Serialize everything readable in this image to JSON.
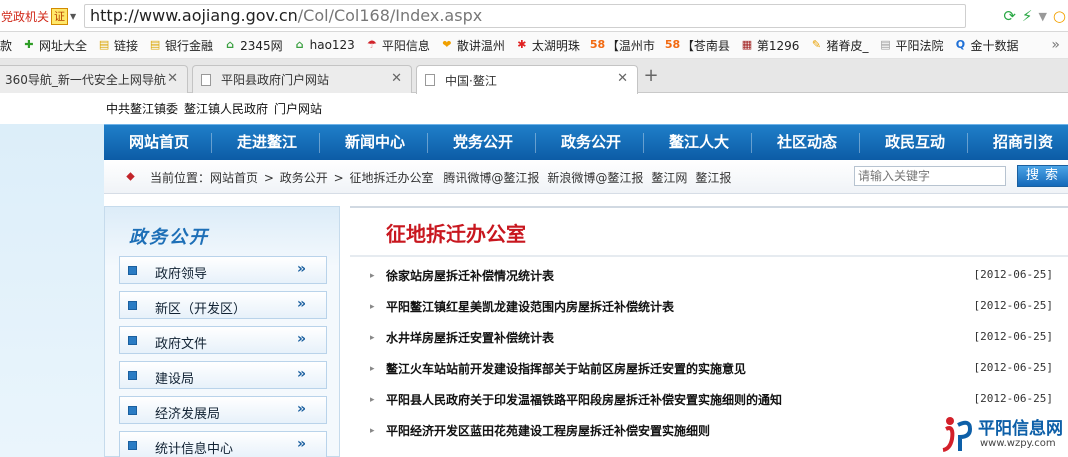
{
  "browser": {
    "org_tag": "党政机关",
    "cert_badge": "证",
    "url_host": "http://www.aojiang.gov.cn",
    "url_path": "/Col/Col168/Index.aspx",
    "bookmarks": [
      {
        "label": "款",
        "icon": "",
        "color": "#333"
      },
      {
        "label": "网址大全",
        "icon": "✚",
        "color": "#2f9d27"
      },
      {
        "label": "链接",
        "icon": "▤",
        "color": "#d9a400"
      },
      {
        "label": "银行金融",
        "icon": "▤",
        "color": "#d9a400"
      },
      {
        "label": "2345网",
        "icon": "⌂",
        "color": "#3aa040"
      },
      {
        "label": "hao123",
        "icon": "⌂",
        "color": "#3aa040"
      },
      {
        "label": "平阳信息",
        "icon": "☂",
        "color": "#d1232a"
      },
      {
        "label": "散讲温州",
        "icon": "❤",
        "color": "#f0a000"
      },
      {
        "label": "太湖明珠",
        "icon": "✱",
        "color": "#e02020"
      },
      {
        "label": "【温州市",
        "icon": "58",
        "color": "#f26a11"
      },
      {
        "label": "【苍南县",
        "icon": "58",
        "color": "#f26a11"
      },
      {
        "label": "第1296",
        "icon": "▦",
        "color": "#a02020"
      },
      {
        "label": "猪脊皮_",
        "icon": "✎",
        "color": "#e8a000"
      },
      {
        "label": "平阳法院",
        "icon": "▤",
        "color": "#999999"
      },
      {
        "label": "金十数据",
        "icon": "Q",
        "color": "#1e6fd6"
      }
    ],
    "bookmarks_more": "»",
    "tabs": [
      {
        "label": "360导航_新一代安全上网导航",
        "active": false
      },
      {
        "label": "平阳县政府门户网站",
        "active": false
      },
      {
        "label": "中国·鳌江",
        "active": true
      }
    ],
    "new_tab": "+"
  },
  "site": {
    "toplinks": [
      "中共鳌江镇委",
      "鳌江镇人民政府",
      "门户网站"
    ],
    "nav": [
      "网站首页",
      "走进鳌江",
      "新闻中心",
      "党务公开",
      "政务公开",
      "鳌江人大",
      "社区动态",
      "政民互动",
      "招商引资"
    ],
    "breadcrumb": {
      "prefix": "当前位置：",
      "items": [
        "网站首页",
        "政务公开",
        "征地拆迁办公室"
      ],
      "separator": ">",
      "links": [
        "腾讯微博@鳌江报",
        "新浪微博@鳌江报",
        "鳌江网",
        "鳌江报"
      ]
    },
    "search": {
      "placeholder": "请输入关键字",
      "button": "搜索"
    },
    "sidebar": {
      "title": "政务公开",
      "items": [
        "政府领导",
        "新区（开发区）",
        "政府文件",
        "建设局",
        "经济发展局",
        "统计信息中心"
      ],
      "arrow": "»"
    },
    "content": {
      "title": "征地拆迁办公室",
      "bullet": "▸",
      "news": [
        {
          "title": "徐家站房屋拆迁补偿情况统计表",
          "date": "[2012-06-25]"
        },
        {
          "title": "平阳鳌江镇红星美凯龙建设范围内房屋拆迁补偿统计表",
          "date": "[2012-06-25]"
        },
        {
          "title": "水井垟房屋拆迁安置补偿统计表",
          "date": "[2012-06-25]"
        },
        {
          "title": "鳌江火车站站前开发建设指挥部关于站前区房屋拆迁安置的实施意见",
          "date": "[2012-06-25]"
        },
        {
          "title": "平阳县人民政府关于印发温福铁路平阳段房屋拆迁补偿安置实施细则的通知",
          "date": "[2012-06-25]"
        },
        {
          "title": "平阳经济开发区蓝田花苑建设工程房屋拆迁补偿安置实施细则",
          "date": ""
        }
      ]
    },
    "watermark": {
      "name": "平阳信息网",
      "url": "www.wzpy.com"
    }
  },
  "colors": {
    "nav_blue": "#0c5ca6",
    "title_red": "#c8171f"
  }
}
